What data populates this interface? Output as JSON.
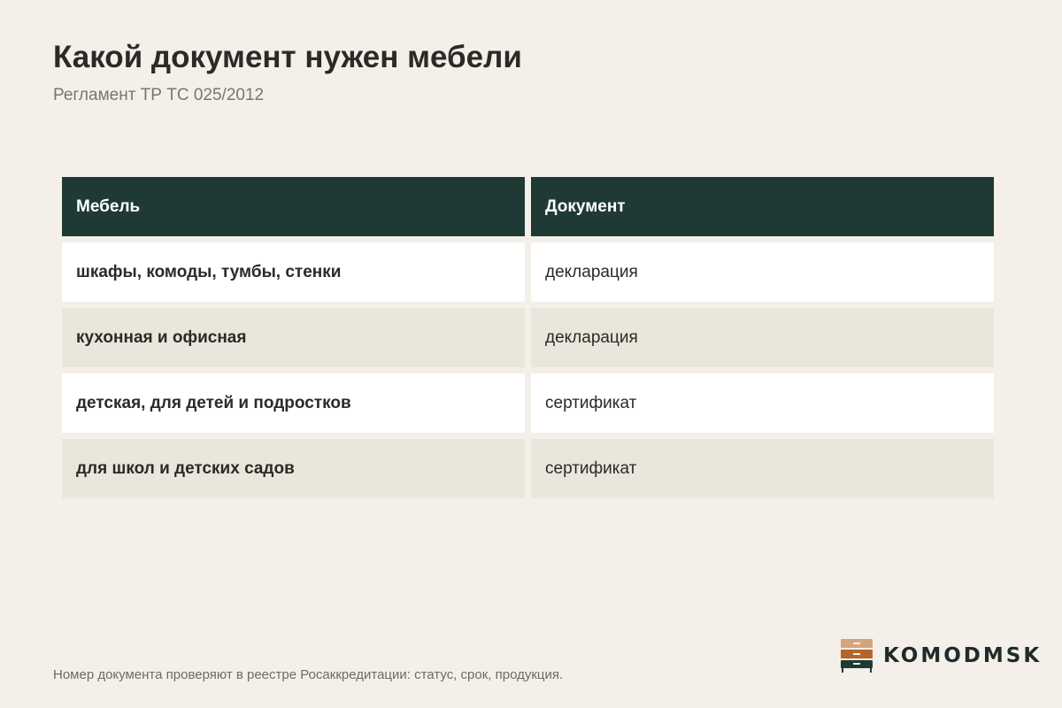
{
  "header": {
    "title": "Какой документ нужен мебели",
    "subtitle": "Регламент ТР ТС 025/2012"
  },
  "table": {
    "columns": [
      "Мебель",
      "Документ"
    ],
    "rows": [
      {
        "furniture": "шкафы, комоды, тумбы, стенки",
        "document": "декларация"
      },
      {
        "furniture": "кухонная и офисная",
        "document": "декларация"
      },
      {
        "furniture": "детская, для детей и подростков",
        "document": "сертификат"
      },
      {
        "furniture": "для школ и детских садов",
        "document": "сертификат"
      }
    ]
  },
  "footer": {
    "note": "Номер документа проверяют в реестре Росаккредитации: статус, срок, продукция."
  },
  "brand": {
    "name": "KOMODMSK",
    "icon": "dresser-icon",
    "colors": {
      "drawer_top": "#d4a57c",
      "drawer_middle": "#b5652a",
      "drawer_bottom": "#1f3a34",
      "header_bg": "#1f3a34",
      "page_bg": "#f4f0e9",
      "row_alt_bg": "#ebe6dc"
    }
  }
}
